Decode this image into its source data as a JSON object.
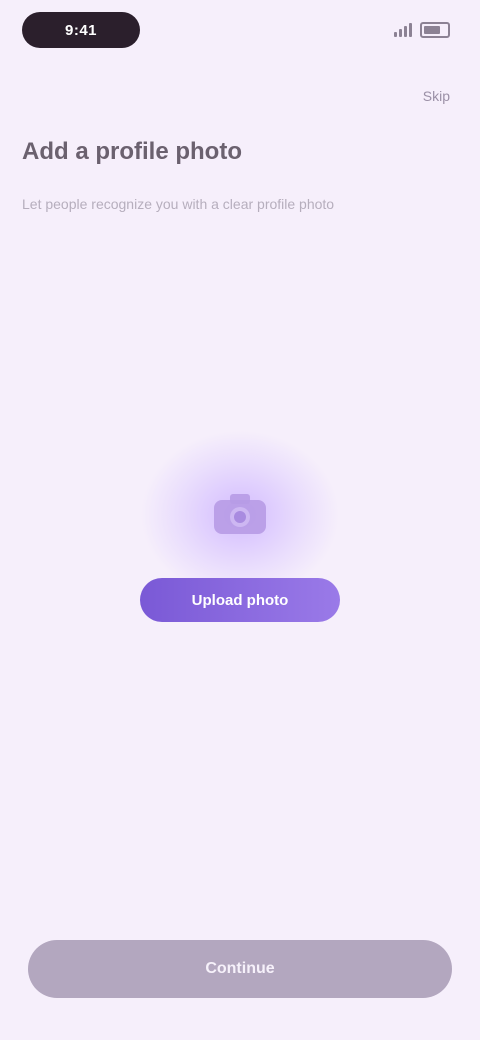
{
  "status": {
    "time": "9:41",
    "signal_icon": "signal-icon",
    "battery_icon": "battery-icon"
  },
  "header": {
    "right_link": "Skip"
  },
  "page": {
    "title": "Add a profile photo",
    "subtitle": "Let people recognize you with a clear profile photo"
  },
  "illustration": {
    "icon": "camera-icon",
    "cta_label": "Upload photo"
  },
  "footer": {
    "primary_button": "Continue"
  },
  "colors": {
    "background": "#f6effb",
    "accent": "#7a59d6",
    "disabled": "#b3a7bf"
  }
}
